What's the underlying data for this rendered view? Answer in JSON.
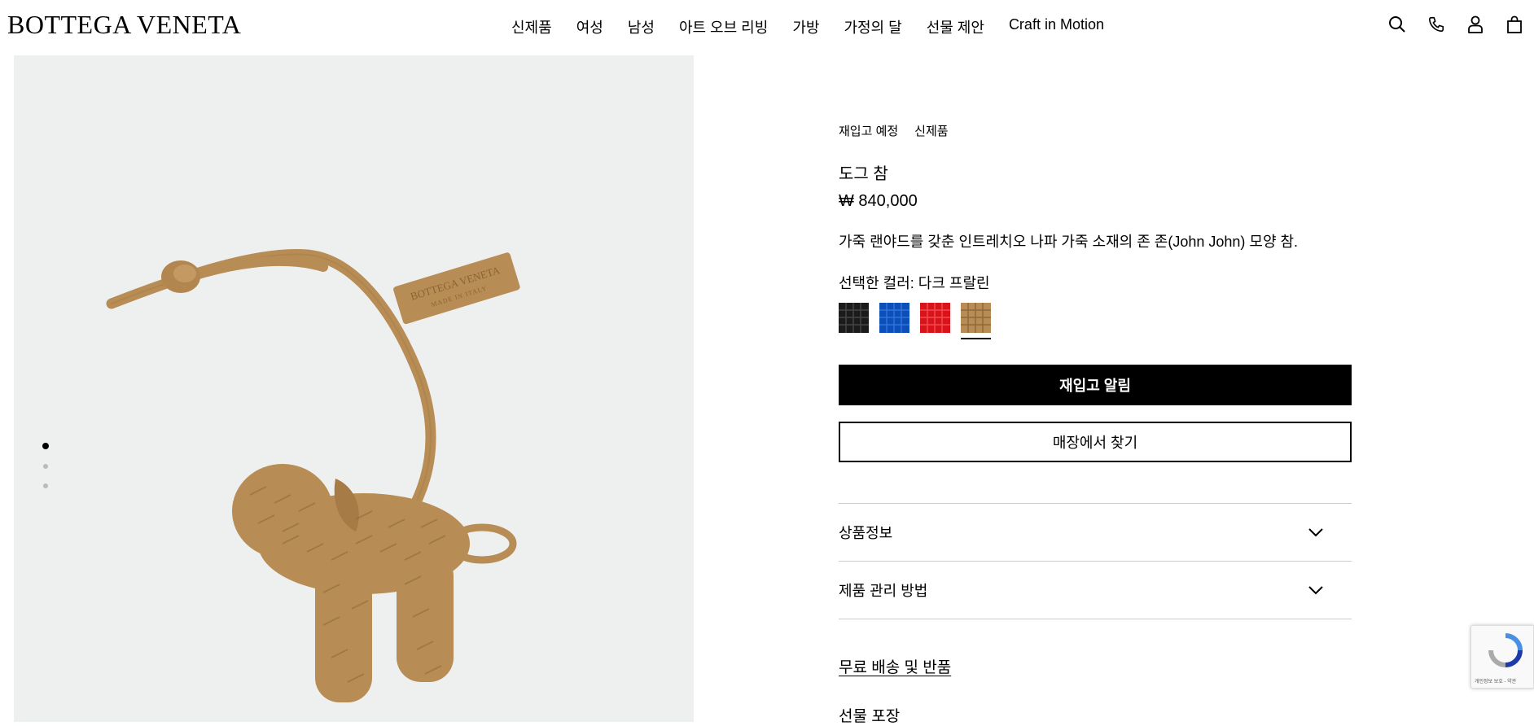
{
  "header": {
    "logo": "BOTTEGA VENETA",
    "nav": [
      "신제품",
      "여성",
      "남성",
      "아트 오브 리빙",
      "가방",
      "가정의 달",
      "선물 제안",
      "Craft in Motion"
    ],
    "icons": [
      "search-icon",
      "phone-icon",
      "account-icon",
      "bag-icon"
    ]
  },
  "gallery": {
    "tag_brand": "BOTTEGA VENETA",
    "tag_sub": "MADE IN ITALY",
    "dots_total": 3,
    "dots_active": 1
  },
  "product": {
    "tags": [
      "재입고 예정",
      "신제품"
    ],
    "title": "도그 참",
    "price": "₩ 840,000",
    "description": "가죽 랜야드를 갖춘 인트레치오 나파 가죽 소재의 존 존(John John) 모양 참.",
    "color_label": "선택한 컬러: 다크 프랄린",
    "swatches": [
      {
        "color": "#1b1b1b",
        "selected": false
      },
      {
        "color": "#0d4fb8",
        "selected": false
      },
      {
        "color": "#d8141a",
        "selected": false
      },
      {
        "color": "#b88c55",
        "selected": true
      }
    ],
    "primary_button": "재입고 알림",
    "secondary_button": "매장에서 찾기",
    "accordion": [
      "상품정보",
      "제품 관리 방법"
    ],
    "shipping_link": "무료 배송 및 반품",
    "gift_link": "선물 포장"
  },
  "recaptcha": {
    "text": "개인정보 보호 - 약관"
  }
}
